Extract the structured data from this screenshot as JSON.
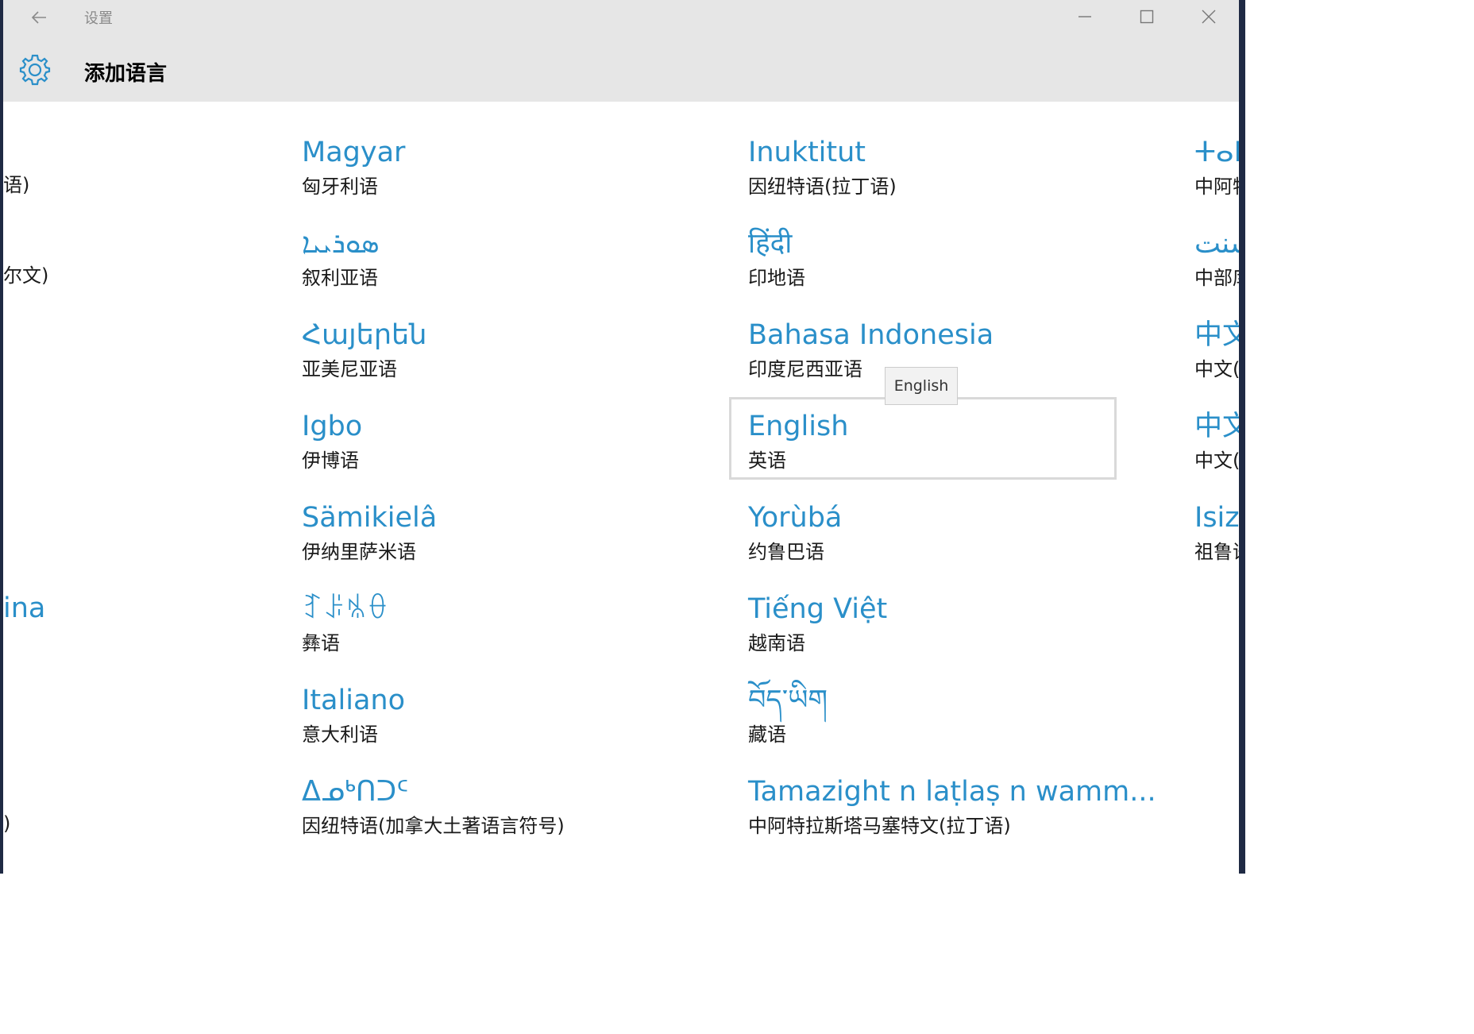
{
  "window": {
    "app_title": "设置",
    "back_icon": "arrow-left-icon",
    "minimize_glyph": "—",
    "maximize_glyph": "☐",
    "close_glyph": "✕"
  },
  "header": {
    "icon": "gear-icon",
    "title": "添加语言",
    "accent": "#2a8fc9"
  },
  "tooltip": "English",
  "partial_left": [
    {
      "text": "语)"
    },
    {
      "text": "尔文)"
    },
    {
      "text": "ina"
    },
    {
      "text": ")"
    }
  ],
  "column_middle": [
    {
      "native": "Magyar",
      "cn": "匈牙利语"
    },
    {
      "native": "ܣܘܪܝܝܐ",
      "cn": "叙利亚语"
    },
    {
      "native": "Հայերեն",
      "cn": "亚美尼亚语"
    },
    {
      "native": "Igbo",
      "cn": "伊博语"
    },
    {
      "native": "Sämikielâ",
      "cn": "伊纳里萨米语"
    },
    {
      "native": "ꆈꌠꁱꂷ",
      "cn": "彝语"
    },
    {
      "native": "Italiano",
      "cn": "意大利语"
    },
    {
      "native": "ᐃᓄᒃᑎᑐᑦ",
      "cn": "因纽特语(加拿大土著语言符号)"
    }
  ],
  "column_right": [
    {
      "native": "Inuktitut",
      "cn": "因纽特语(拉丁语)"
    },
    {
      "native": "हिंदी",
      "cn": "印地语"
    },
    {
      "native": "Bahasa Indonesia",
      "cn": "印度尼西亚语"
    },
    {
      "native": "English",
      "cn": "英语",
      "selected": true
    },
    {
      "native": "Yorùbá",
      "cn": "约鲁巴语"
    },
    {
      "native": "Tiếng Việt",
      "cn": "越南语"
    },
    {
      "native": "བོད་ཡིག",
      "cn": "藏语"
    },
    {
      "native": "Tamazight n laṭlaṣ n wamm...",
      "cn": "中阿特拉斯塔马塞特文(拉丁语)"
    }
  ],
  "column_far_right": [
    {
      "native": "ⵜⴰⵎ",
      "cn": "中阿特"
    },
    {
      "native": "سنت",
      "cn": "中部库"
    },
    {
      "native": "中文",
      "cn": "中文("
    },
    {
      "native": "中文",
      "cn": "中文("
    },
    {
      "native": "Isizu",
      "cn": "祖鲁语"
    }
  ]
}
